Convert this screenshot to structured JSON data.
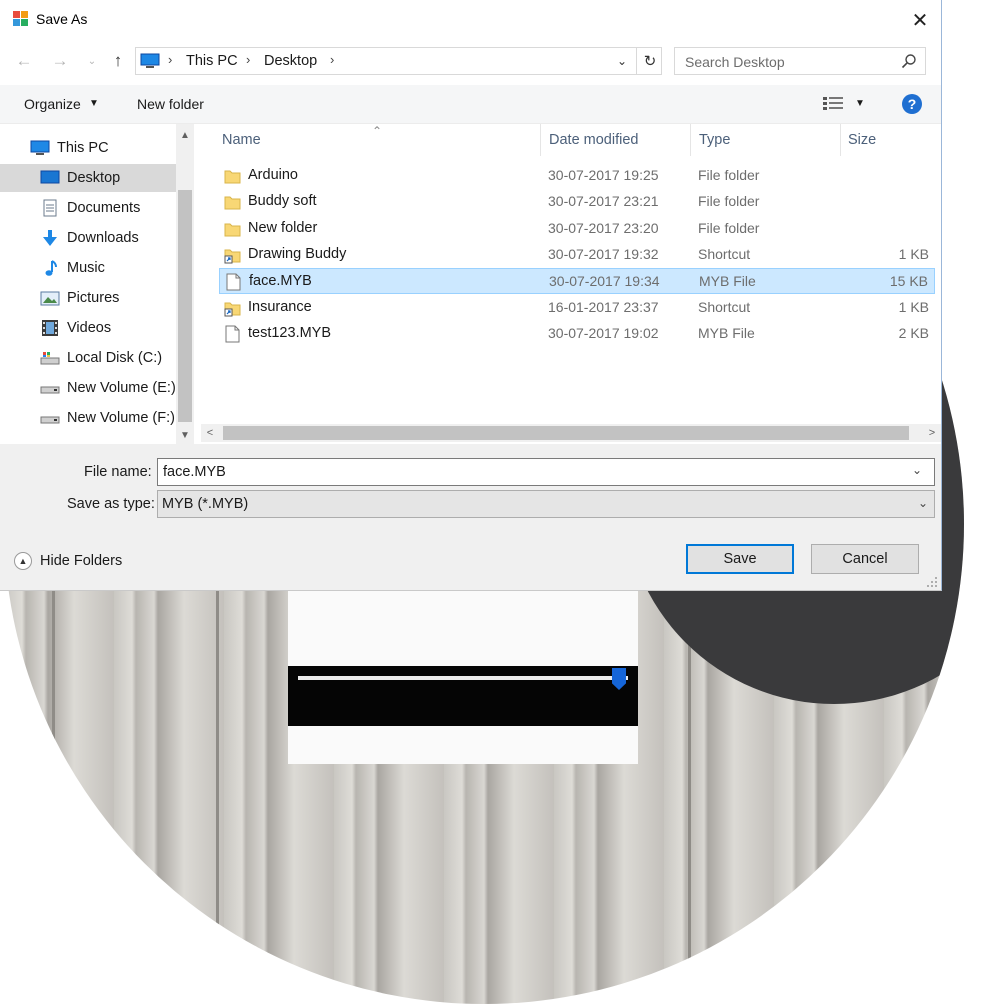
{
  "window": {
    "title": "Save As"
  },
  "address": {
    "segments": [
      "This PC",
      "Desktop"
    ]
  },
  "search": {
    "placeholder": "Search Desktop"
  },
  "toolbar": {
    "organize": "Organize",
    "new_folder": "New folder",
    "help": "?"
  },
  "nav": {
    "items": [
      {
        "label": "This PC",
        "icon": "computer-icon",
        "indent": 0,
        "selected": false
      },
      {
        "label": "Desktop",
        "icon": "desktop-icon",
        "indent": 1,
        "selected": true
      },
      {
        "label": "Documents",
        "icon": "documents-icon",
        "indent": 1,
        "selected": false
      },
      {
        "label": "Downloads",
        "icon": "downloads-icon",
        "indent": 1,
        "selected": false
      },
      {
        "label": "Music",
        "icon": "music-icon",
        "indent": 1,
        "selected": false
      },
      {
        "label": "Pictures",
        "icon": "pictures-icon",
        "indent": 1,
        "selected": false
      },
      {
        "label": "Videos",
        "icon": "videos-icon",
        "indent": 1,
        "selected": false
      },
      {
        "label": "Local Disk (C:)",
        "icon": "local-disk-icon",
        "indent": 1,
        "selected": false
      },
      {
        "label": "New Volume (E:)",
        "icon": "drive-icon",
        "indent": 1,
        "selected": false
      },
      {
        "label": "New Volume (F:)",
        "icon": "drive-icon",
        "indent": 1,
        "selected": false
      }
    ]
  },
  "columns": {
    "name": "Name",
    "date": "Date modified",
    "type": "Type",
    "size": "Size"
  },
  "files": [
    {
      "name": "Arduino",
      "date": "30-07-2017 19:25",
      "type": "File folder",
      "size": "",
      "icon": "folder-icon",
      "selected": false
    },
    {
      "name": "Buddy soft",
      "date": "30-07-2017 23:21",
      "type": "File folder",
      "size": "",
      "icon": "folder-icon",
      "selected": false
    },
    {
      "name": "New folder",
      "date": "30-07-2017 23:20",
      "type": "File folder",
      "size": "",
      "icon": "folder-icon",
      "selected": false
    },
    {
      "name": "Drawing Buddy",
      "date": "30-07-2017 19:32",
      "type": "Shortcut",
      "size": "1 KB",
      "icon": "shortcut-folder-icon",
      "selected": false
    },
    {
      "name": "face.MYB",
      "date": "30-07-2017 19:34",
      "type": "MYB File",
      "size": "15 KB",
      "icon": "file-icon",
      "selected": true
    },
    {
      "name": "Insurance",
      "date": "16-01-2017 23:37",
      "type": "Shortcut",
      "size": "1 KB",
      "icon": "shortcut-folder-icon",
      "selected": false
    },
    {
      "name": "test123.MYB",
      "date": "30-07-2017 19:02",
      "type": "MYB File",
      "size": "2 KB",
      "icon": "file-icon",
      "selected": false
    }
  ],
  "form": {
    "file_name_label": "File name:",
    "file_name_value": "face.MYB",
    "save_type_label": "Save as type:",
    "save_type_value": "MYB (*.MYB)"
  },
  "footer": {
    "hide_folders": "Hide Folders",
    "save": "Save",
    "cancel": "Cancel"
  },
  "colors": {
    "accent": "#0078d7",
    "selection": "#cce8ff",
    "folder": "#f8d775",
    "help": "#1f6fd1"
  }
}
